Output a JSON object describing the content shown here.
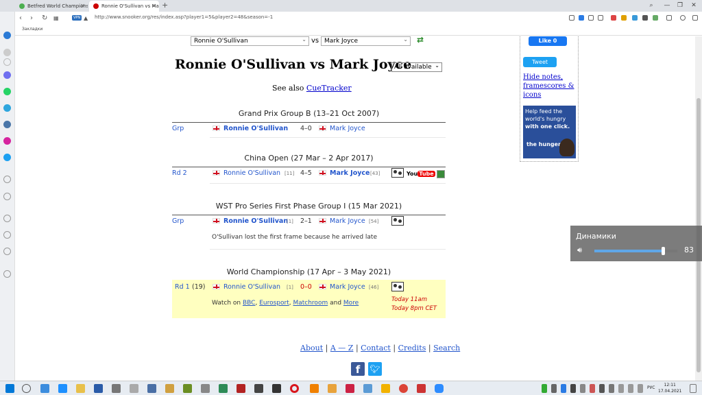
{
  "browser": {
    "tabs": [
      {
        "label": "Betfred World Championsh",
        "active": false
      },
      {
        "label": "Ronnie O'Sullivan vs Mark",
        "active": true
      }
    ],
    "new_tab": "+",
    "vpn_label": "VPN",
    "url": "http://www.snooker.org/res/index.asp?player1=5&player2=48&season=-1",
    "bookmarks_label": "Закладки"
  },
  "colors": {
    "link": "#0000cc",
    "accent_blue": "#2255cc",
    "highlight": "#ffffc0",
    "red_time": "#cc0000"
  },
  "page": {
    "player1_select": "Ronnie O'Sullivan",
    "vs_label": "vs",
    "player2_select": "Mark Joyce",
    "title": "Ronnie O'Sullivan vs Mark Joyce",
    "season_select": "All available",
    "see_also_prefix": "See also",
    "see_also_link": "CueTracker",
    "sections": [
      {
        "heading": "Grand Prix Group B (13–21 Oct 2007)",
        "round": "Grp",
        "p1": "Ronnie O'Sullivan",
        "p1_seed": "",
        "score": "4–0",
        "p2": "Mark Joyce",
        "p2_seed": ""
      },
      {
        "heading": "China Open (27 Mar – 2 Apr 2017)",
        "round": "Rd 2",
        "p1": "Ronnie O'Sullivan",
        "p1_seed": "[11]",
        "score": "4–5",
        "p2": "Mark Joyce",
        "p2_seed": "[43]",
        "youtube": "YouTube"
      },
      {
        "heading": "WST Pro Series First Phase Group I (15 Mar 2021)",
        "round": "Grp",
        "p1": "Ronnie O'Sullivan",
        "p1_seed": "[1]",
        "score": "2–1",
        "p2": "Mark Joyce",
        "p2_seed": "[54]",
        "note": "O'Sullivan lost the first frame because he arrived late"
      },
      {
        "heading": "World Championship (17 Apr – 3 May 2021)",
        "round": "Rd 1",
        "round_num": "(19)",
        "p1": "Ronnie O'Sullivan",
        "p1_seed": "[1]",
        "score": "0–0",
        "p2": "Mark Joyce",
        "p2_seed": "[46]",
        "watch_prefix": "Watch on",
        "watch_links": [
          "BBC",
          "Eurosport",
          "Matchroom"
        ],
        "watch_and": "and",
        "watch_more": "More",
        "time1": "Today 11am",
        "time2": "Today 8pm CET"
      }
    ],
    "footer": {
      "about": "About",
      "az": "A — Z",
      "contact": "Contact",
      "credits": "Credits",
      "search": "Search",
      "sep": "|"
    }
  },
  "right": {
    "fb_like": "Like 0",
    "tweet": "Tweet",
    "hide_notes": "Hide notes, framescores & icons",
    "ad_line1": "Help feed the world's hungry",
    "ad_line2": "with one click.",
    "ad_logo": "the hunger site"
  },
  "volume": {
    "label": "Динамики",
    "level": 83,
    "level_text": "83"
  },
  "taskbar": {
    "lang": "РУС",
    "time": "12:11",
    "date": "17.04.2021"
  }
}
